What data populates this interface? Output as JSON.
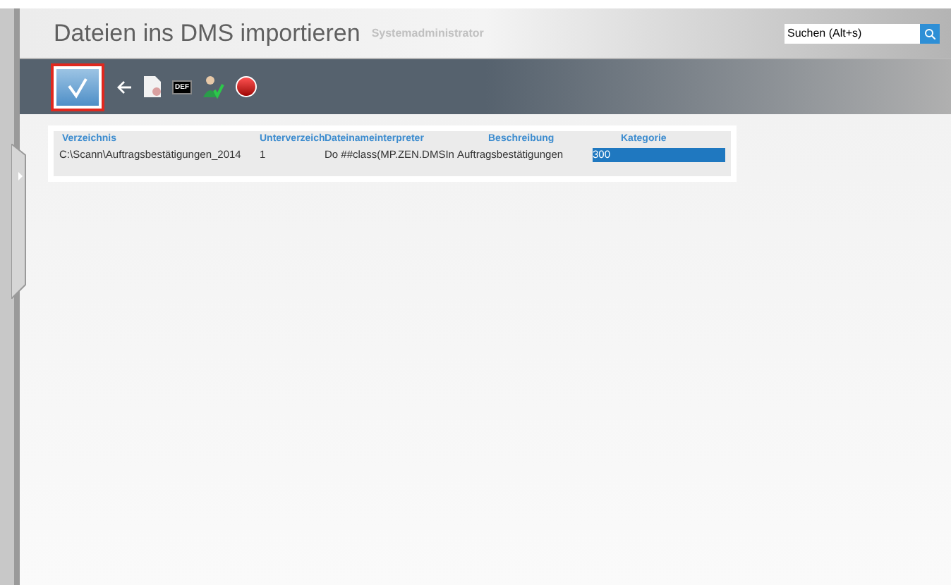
{
  "header": {
    "title": "Dateien ins DMS importieren",
    "user": "Systemadministrator"
  },
  "search": {
    "placeholder": "Suchen (Alt+s)"
  },
  "toolbar": [
    {
      "kind": "confirm",
      "highlighted": true
    },
    {
      "kind": "back"
    },
    {
      "kind": "document"
    },
    {
      "kind": "def",
      "label": "DEF"
    },
    {
      "kind": "user-check"
    },
    {
      "kind": "stop"
    }
  ],
  "table": {
    "columns": [
      "Verzeichnis",
      "Unterverzeich",
      "Dateinameinterpreter",
      "Beschreibung",
      "Kategorie"
    ],
    "rows": [
      {
        "cells": [
          {
            "text": "C:\\Scann\\Auftragsbestätigungen_2014",
            "selected": false
          },
          {
            "text": "1",
            "selected": false
          },
          {
            "text": "Do ##class(MP.ZEN.DMSIn",
            "selected": false
          },
          {
            "text": "Auftragsbestätigungen",
            "selected": false
          },
          {
            "text": "300",
            "selected": true
          }
        ]
      }
    ]
  }
}
